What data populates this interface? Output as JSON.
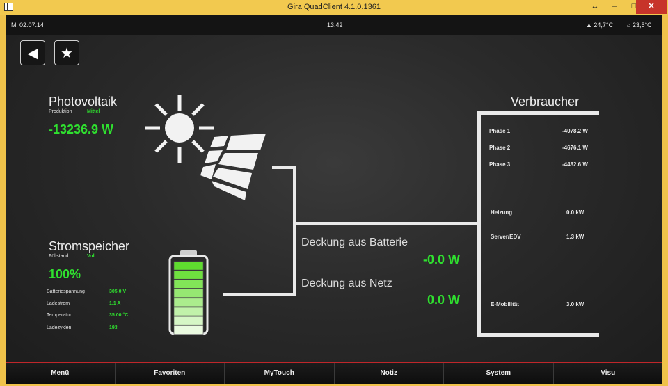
{
  "window": {
    "title": "Gira QuadClient 4.1.0.1361",
    "resize_glyph": "↔",
    "min_glyph": "–",
    "max_glyph": "□",
    "close_glyph": "✕"
  },
  "status": {
    "date": "Mi 02.07.14",
    "time": "13:42",
    "temp_outside": "24,7°C",
    "temp_inside": "23,5°C"
  },
  "nav": {
    "back_glyph": "◀",
    "favorite_glyph": "★"
  },
  "pv": {
    "title": "Photovoltaik",
    "sub_label": "Produktion",
    "sub_value": "Mittel",
    "power": "-13236.9 W"
  },
  "storage": {
    "title": "Stromspeicher",
    "sub_label": "Füllstand",
    "sub_value": "Voll",
    "level": "100%",
    "level_fraction": 1.0,
    "rows": [
      {
        "label": "Batteriespannung",
        "value": "305.0 V"
      },
      {
        "label": "Ladestrom",
        "value": "1.1 A"
      },
      {
        "label": "Temperatur",
        "value": "35.00 °C"
      },
      {
        "label": "Ladezyklen",
        "value": "193"
      }
    ]
  },
  "coverage": {
    "battery_label": "Deckung aus Batterie",
    "battery_value": "-0.0 W",
    "grid_label": "Deckung aus Netz",
    "grid_value": "0.0 W"
  },
  "consumer": {
    "title": "Verbraucher",
    "phases": [
      {
        "label": "Phase 1",
        "value": "-4078.2 W"
      },
      {
        "label": "Phase 2",
        "value": "-4676.1 W"
      },
      {
        "label": "Phase 3",
        "value": "-4482.6 W"
      }
    ],
    "loads": [
      {
        "label": "Heizung",
        "value": "0.0 kW"
      },
      {
        "label": "Server/EDV",
        "value": "1.3 kW"
      },
      {
        "label": "E-Mobilität",
        "value": "3.0 kW"
      }
    ]
  },
  "menu": [
    "Menü",
    "Favoriten",
    "MyTouch",
    "Notiz",
    "System",
    "Visu"
  ],
  "colors": {
    "accent_green": "#2fe02f",
    "menu_red": "#c0262a",
    "titlebar": "#f2c94f"
  }
}
